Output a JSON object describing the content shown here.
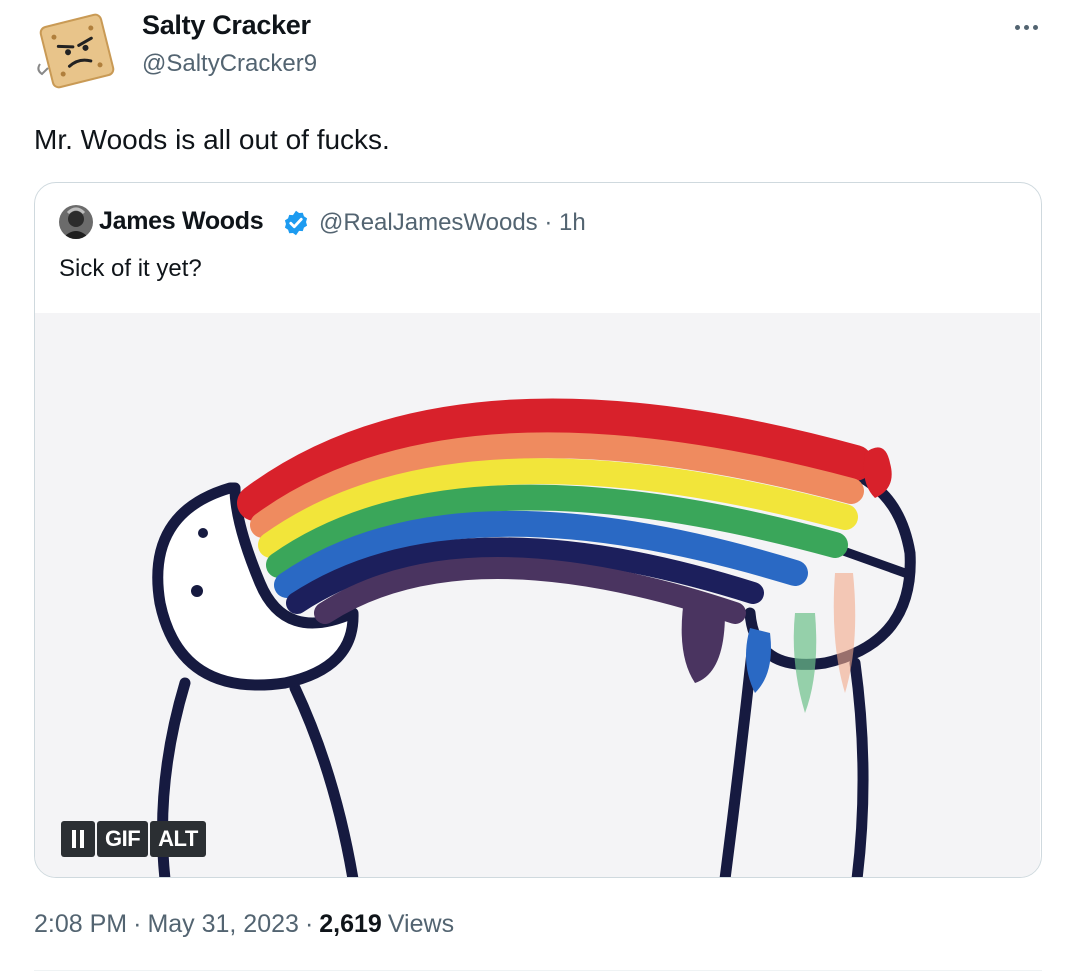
{
  "author": {
    "name": "Salty Cracker",
    "handle": "@SaltyCracker9",
    "avatar_icon": "cracker-avatar-icon"
  },
  "tweet_text": "Mr. Woods is all out of fucks.",
  "more_icon": "more-options-icon",
  "quoted": {
    "name": "James Woods",
    "verified_icon": "verified-badge-icon",
    "handle_time": "@RealJamesWoods · 1h",
    "text": "Sick of it yet?",
    "media": {
      "type": "gif",
      "icon": "rainbow-vomit-character",
      "controls": {
        "pause_icon": "pause-icon",
        "gif_label": "GIF",
        "alt_label": "ALT"
      }
    }
  },
  "meta": {
    "time": "2:08 PM",
    "sep1": "·",
    "date": "May 31, 2023",
    "sep2": "·",
    "views_count": "2,619",
    "views_label": "Views"
  },
  "colors": {
    "text_primary": "#0f1419",
    "text_secondary": "#536471",
    "border": "#cfd9de",
    "verified": "#1d9bf0"
  }
}
